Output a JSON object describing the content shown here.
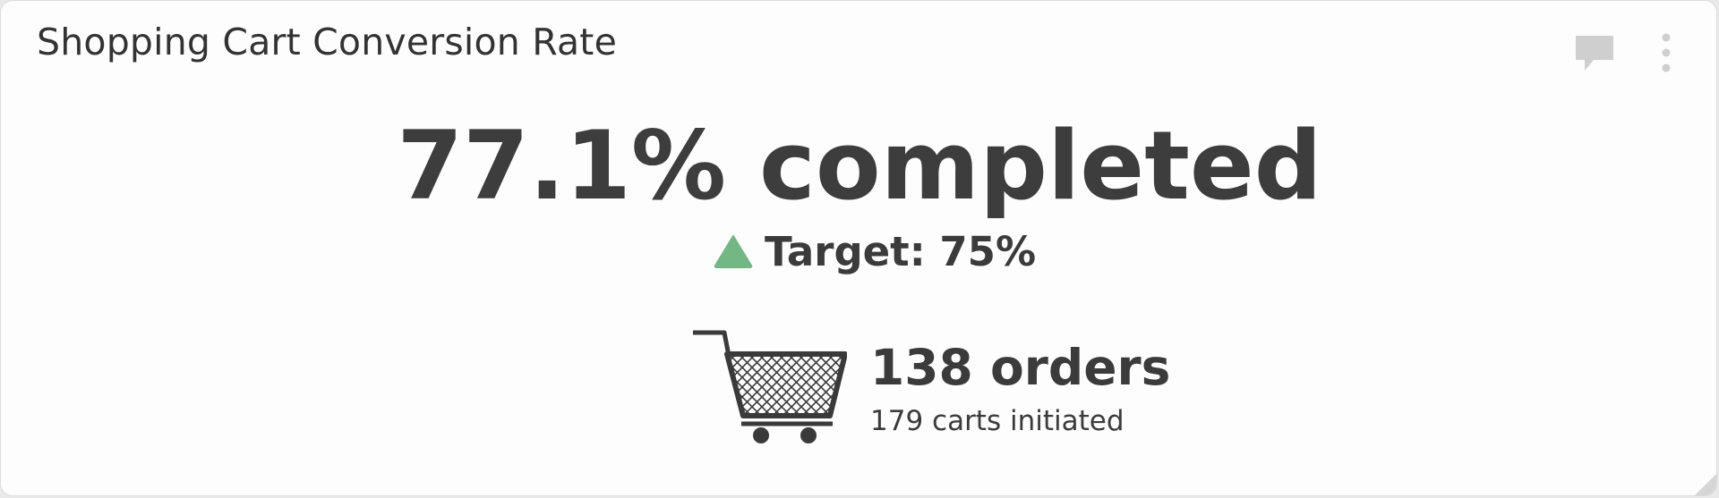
{
  "widget": {
    "title": "Shopping Cart Conversion Rate",
    "main_value": "77.1% completed",
    "target_text": "Target: 75%",
    "target_status": "up",
    "orders_text": "138 orders",
    "carts_text": "179 carts initiated"
  },
  "icons": {
    "comment": "comment-icon",
    "menu": "more-vertical-icon",
    "cart": "shopping-cart-icon",
    "status": "triangle-up-icon"
  },
  "colors": {
    "status_up": "#72b784",
    "text": "#3b3b3b",
    "icon_muted": "#cfcfcf"
  }
}
